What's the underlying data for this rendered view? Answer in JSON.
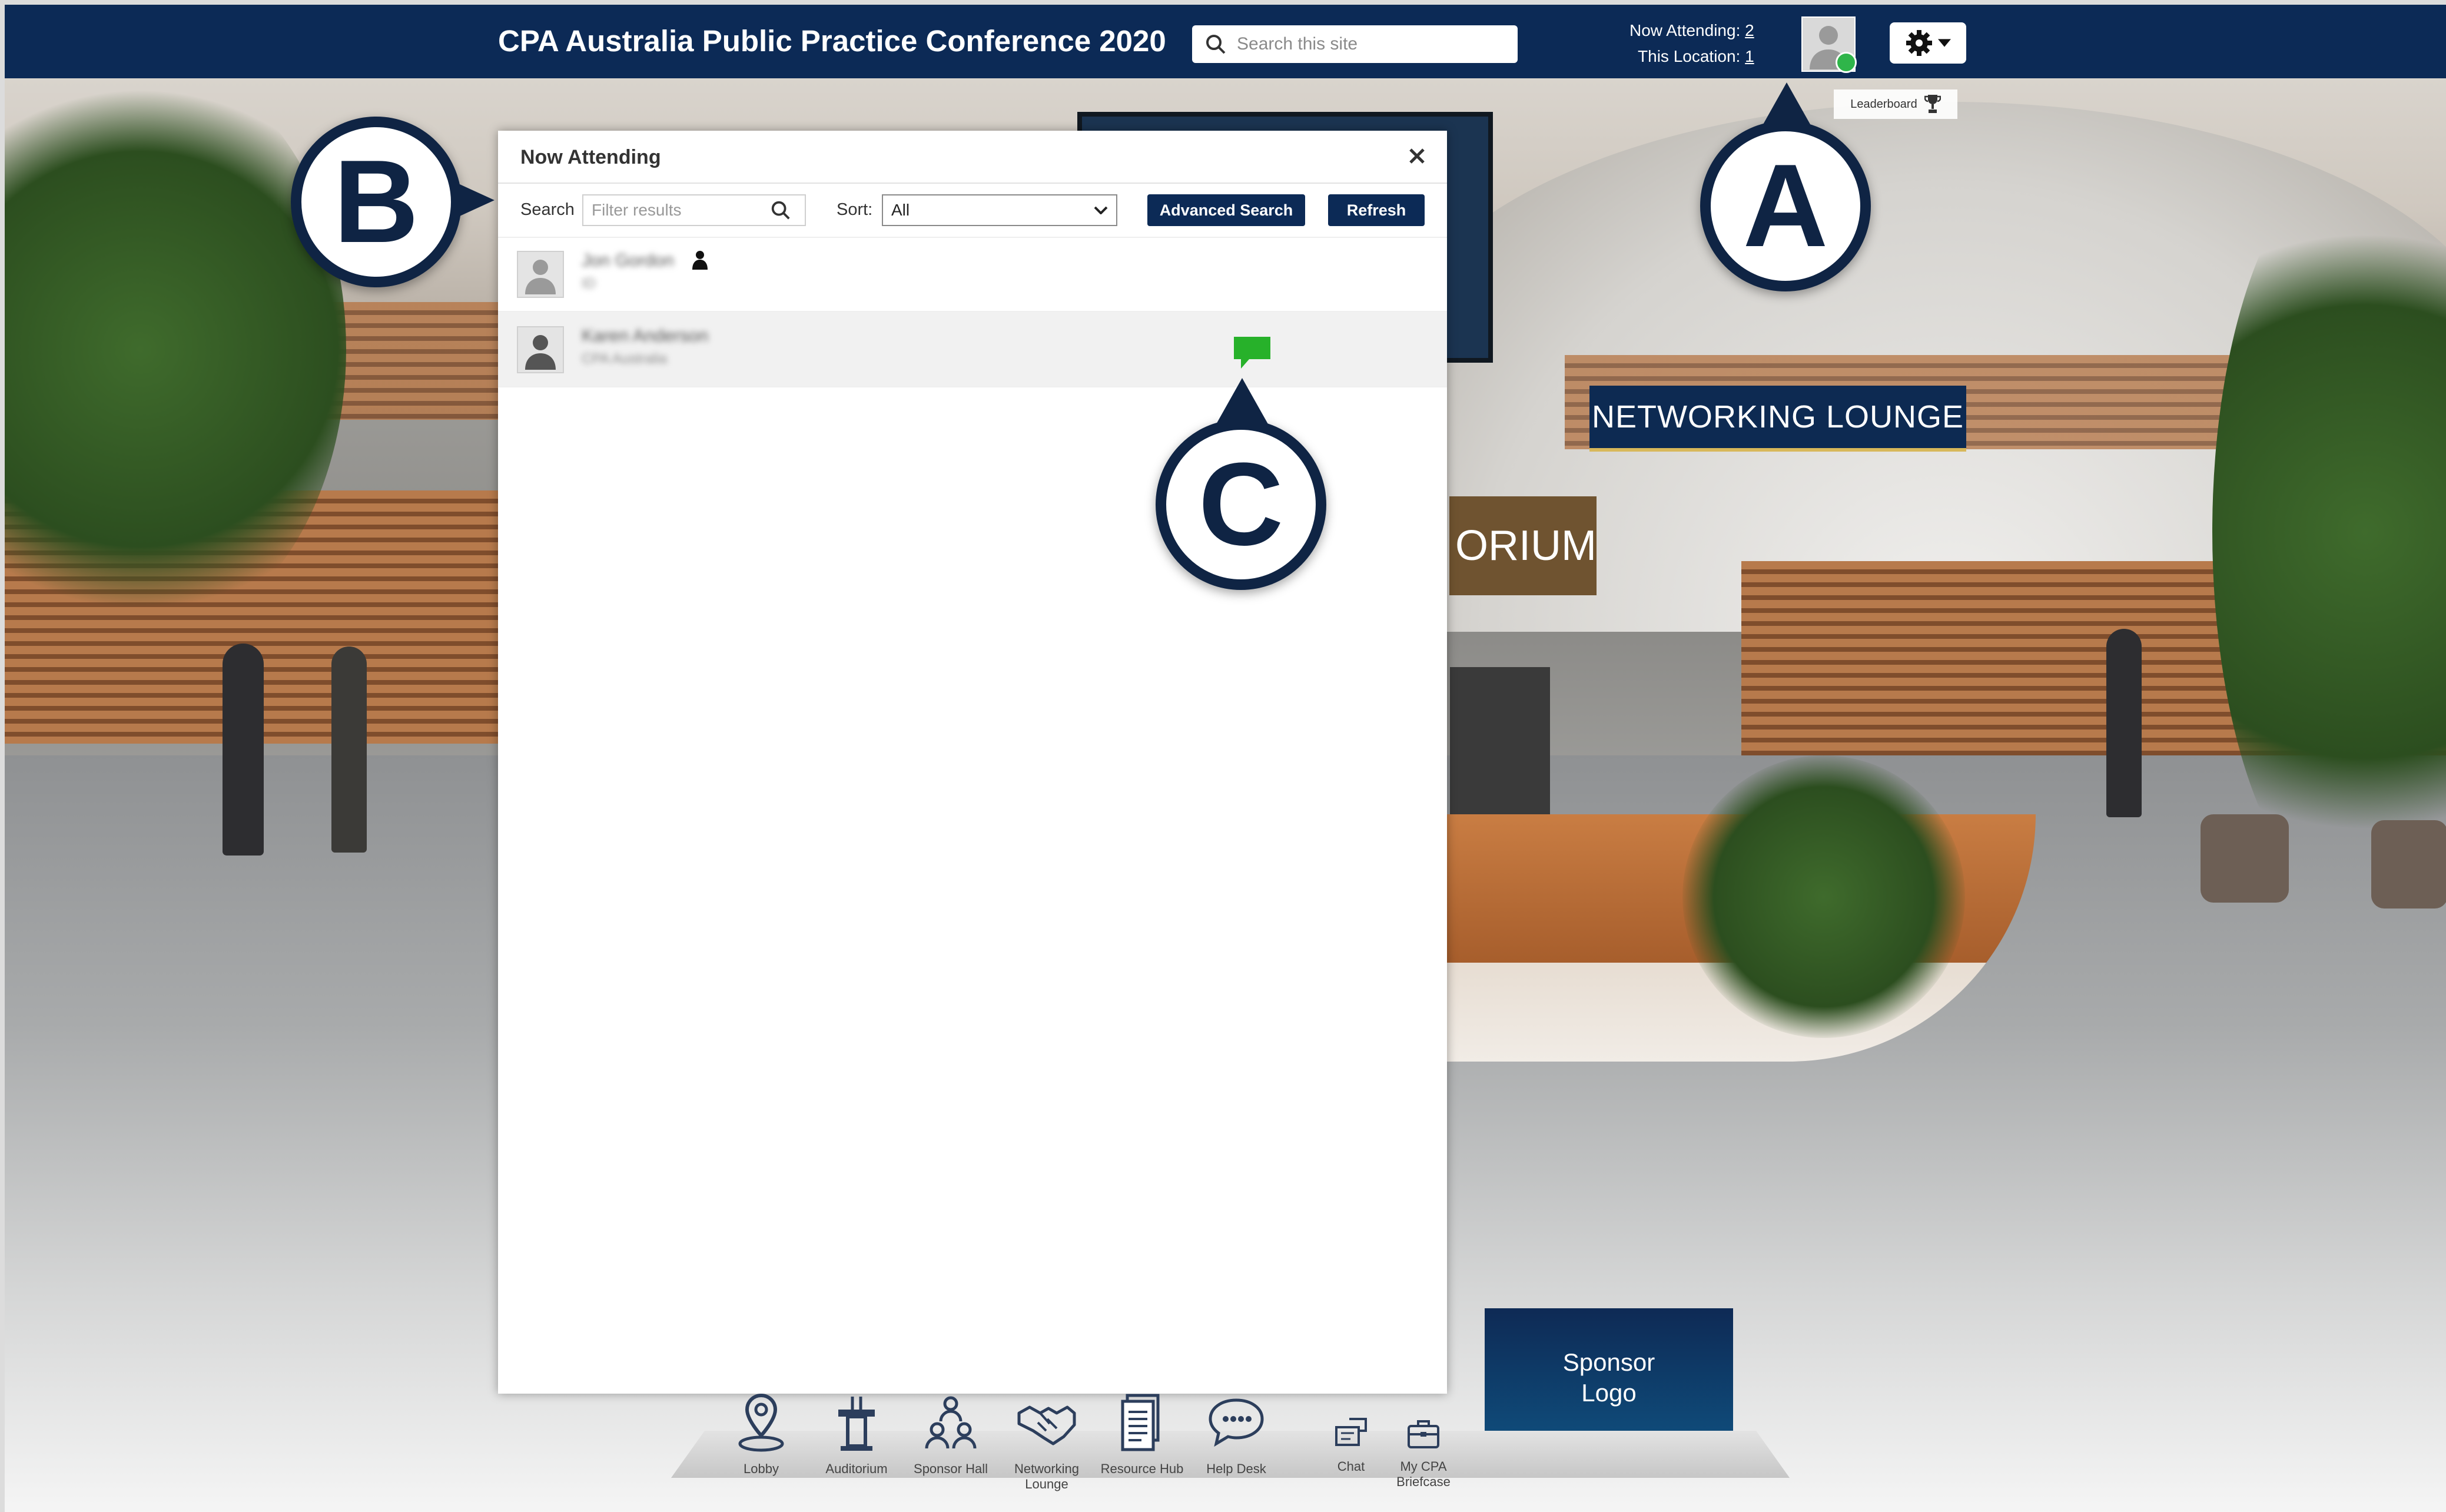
{
  "topbar": {
    "title": "CPA Australia Public Practice Conference 2020",
    "search_placeholder": "Search this site",
    "now_attending_label": "Now Attending:",
    "now_attending_value": "2",
    "this_location_label": "This Location:",
    "this_location_value": "1"
  },
  "leaderboard_label": "Leaderboard",
  "modal": {
    "title": "Now Attending",
    "search_label": "Search",
    "filter_placeholder": "Filter results",
    "sort_label": "Sort:",
    "sort_value": "All",
    "advanced_search_label": "Advanced Search",
    "refresh_label": "Refresh",
    "attendees": [
      {
        "name": "Jon Gordon",
        "subtitle": "ID"
      },
      {
        "name": "Karen Anderson",
        "subtitle": "CPA Australia"
      }
    ]
  },
  "callouts": {
    "a": "A",
    "b": "B",
    "c": "C"
  },
  "venue": {
    "networking_sign": "NETWORKING LOUNGE",
    "auditorium_sign": "ORIUM",
    "sponsor_line1": "Sponsor",
    "sponsor_line2": "Logo"
  },
  "nav": [
    {
      "label": "Lobby",
      "icon": "map-pin-icon"
    },
    {
      "label": "Auditorium",
      "icon": "podium-icon"
    },
    {
      "label": "Sponsor Hall",
      "icon": "people-group-icon"
    },
    {
      "label": "Networking Lounge",
      "icon": "handshake-icon"
    },
    {
      "label": "Resource Hub",
      "icon": "document-icon"
    },
    {
      "label": "Help Desk",
      "icon": "chat-bubble-icon"
    },
    {
      "label": "Chat",
      "icon": "chat-icon"
    },
    {
      "label": "My CPA Briefcase",
      "icon": "briefcase-icon"
    }
  ],
  "colors": {
    "brand_navy": "#0c2a56",
    "online_green": "#2fb54a",
    "chat_green": "#27b12a"
  }
}
